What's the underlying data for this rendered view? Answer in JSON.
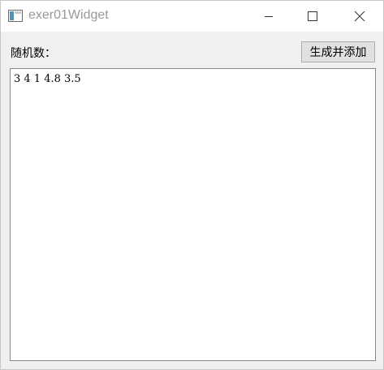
{
  "window": {
    "title": "exer01Widget",
    "app_icon": "window-app-icon",
    "controls": {
      "minimize_icon": "minimize-icon",
      "maximize_icon": "maximize-icon",
      "close_icon": "close-icon"
    }
  },
  "form": {
    "label": "随机数：",
    "button_label": "生成并添加",
    "output_text": "3 4 1 4.8 3.5"
  }
}
